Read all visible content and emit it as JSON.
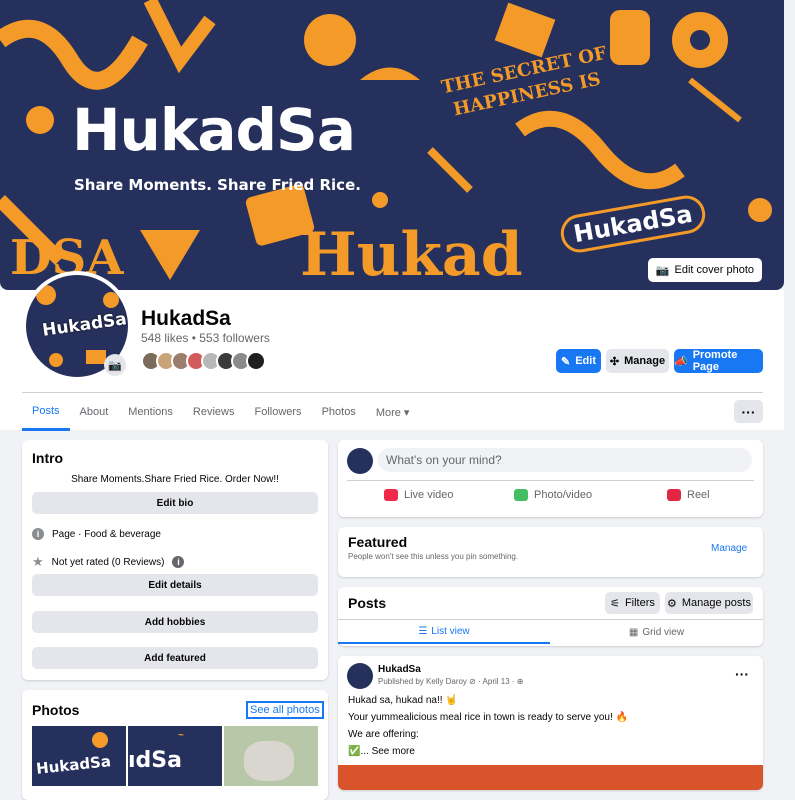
{
  "cover": {
    "brand": "HukadSa",
    "tagline": "Share Moments. Share Fried Rice.",
    "decor_secret": "THE SECRET OF",
    "decor_happiness": "HAPPINESS IS",
    "decor_badge": "HukadSa",
    "edit_cover_label": "Edit cover photo"
  },
  "page": {
    "name": "HukadSa",
    "stats": "548 likes • 553 followers",
    "avatar_text": "HukadSa"
  },
  "actions": {
    "edit": "Edit",
    "manage": "Manage",
    "promote": "Promote Page"
  },
  "tabs": [
    "Posts",
    "About",
    "Mentions",
    "Reviews",
    "Followers",
    "Photos",
    "More ▾"
  ],
  "more_dots": "···",
  "intro": {
    "title": "Intro",
    "bio": "Share Moments.Share Fried Rice. Order Now!!",
    "edit_bio": "Edit bio",
    "category": "Page · Food & beverage",
    "rating": "Not yet rated (0 Reviews)",
    "edit_details": "Edit details",
    "add_hobbies": "Add hobbies",
    "add_featured": "Add featured"
  },
  "photos": {
    "title": "Photos",
    "see_all": "See all photos",
    "thumb1_text": "HukadSa",
    "thumb2_text": "ıdSa"
  },
  "composer": {
    "placeholder": "What's on your mind?",
    "live": "Live video",
    "photo": "Photo/video",
    "reel": "Reel"
  },
  "featured": {
    "title": "Featured",
    "subtitle": "People won't see this unless you pin something.",
    "manage": "Manage"
  },
  "posts_header": {
    "title": "Posts",
    "filters": "Filters",
    "manage_posts": "Manage posts",
    "list_view": "List view",
    "grid_view": "Grid view"
  },
  "post": {
    "author": "HukadSa",
    "meta": "Published by Kelly Daroy ⊘ · April 13 · ⊕",
    "line1": "Hukad sa, hukad na!! 🤘",
    "line2": "Your yummealicious meal rice in town is ready to serve you! 🔥",
    "line3": "We are offering:",
    "see_more": "✅... See more",
    "menu": "···"
  },
  "colors": {
    "brand_navy": "#26305c",
    "brand_orange": "#f39a28",
    "facebook_blue": "#1877f2"
  }
}
